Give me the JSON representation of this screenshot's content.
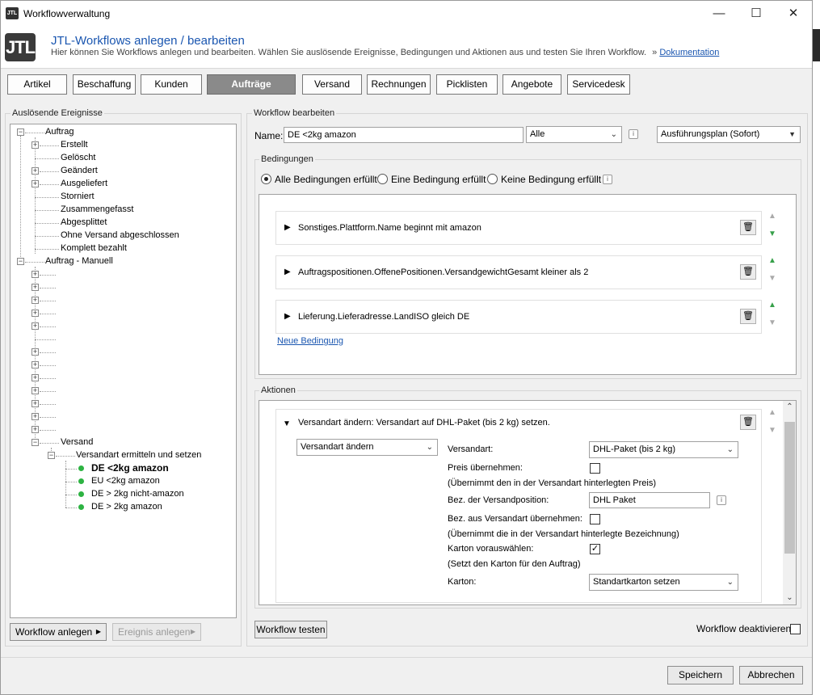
{
  "window": {
    "title": "Workflowverwaltung",
    "icon_text": "JTL"
  },
  "header": {
    "logo": "JTL",
    "title": "JTL-Workflows anlegen / bearbeiten",
    "subtitle": "Hier können Sie Workflows anlegen und bearbeiten. Wählen Sie auslösende Ereignisse, Bedingungen und Aktionen aus und testen Sie Ihren Workflow.",
    "doc_prefix": "»",
    "doc_link": "Dokumentation"
  },
  "categories": [
    "Artikel",
    "Beschaffung",
    "Kunden",
    "Aufträge",
    "Versand",
    "Rechnungen",
    "Picklisten",
    "Angebote",
    "Servicedesk"
  ],
  "events": {
    "label": "Auslösende Ereignisse",
    "auftrag": "Auftrag",
    "auftrag_children": [
      "Erstellt",
      "Gelöscht",
      "Geändert",
      "Ausgeliefert",
      "Storniert",
      "Zusammengefasst",
      "Abgesplittet",
      "Ohne Versand abgeschlossen",
      "Komplett bezahlt"
    ],
    "manuell": "Auftrag - Manuell",
    "versand": "Versand",
    "versand_child": "Versandart ermitteln und setzen",
    "workflows": [
      "DE <2kg amazon",
      "EU <2kg amazon",
      "DE > 2kg nicht-amazon",
      "DE > 2kg amazon"
    ]
  },
  "left_buttons": {
    "create": "Workflow anlegen",
    "create_event": "Ereignis anlegen"
  },
  "workflow": {
    "label": "Workflow bearbeiten",
    "name_label": "Name:",
    "name_value": "DE <2kg amazon",
    "scope": "Alle",
    "plan": "Ausführungsplan (Sofort)"
  },
  "conditions": {
    "label": "Bedingungen",
    "options": [
      "Alle Bedingungen erfüllt",
      "Eine Bedingung erfüllt",
      "Keine Bedingung erfüllt"
    ],
    "items": [
      "Sonstiges.Plattform.Name beginnt mit amazon",
      "Auftragspositionen.OffenePositionen.VersandgewichtGesamt kleiner als 2",
      "Lieferung.Lieferadresse.LandISO gleich DE"
    ],
    "new_link": "Neue Bedingung"
  },
  "actions": {
    "label": "Aktionen",
    "title": "Versandart ändern: Versandart auf DHL-Paket (bis 2 kg) setzen.",
    "type": "Versandart ändern",
    "versandart_label": "Versandart:",
    "versandart_value": "DHL-Paket (bis 2 kg)",
    "preis_label": "Preis übernehmen:",
    "preis_note": "(Übernimmt den in der Versandart hinterlegten Preis)",
    "bez_label": "Bez. der Versandposition:",
    "bez_value": "DHL Paket",
    "bez_aus_label": "Bez. aus Versandart übernehmen:",
    "bez_aus_note": "(Übernimmt die in der Versandart hinterlegte Bezeichnung)",
    "karton_vor_label": "Karton vorauswählen:",
    "karton_vor_note": "(Setzt den Karton für den Auftrag)",
    "karton_label": "Karton:",
    "karton_value": "Standartkarton setzen",
    "check_mark": "✓"
  },
  "bottom": {
    "test": "Workflow testen",
    "deactivate": "Workflow deaktivieren",
    "save": "Speichern",
    "cancel": "Abbrechen"
  }
}
